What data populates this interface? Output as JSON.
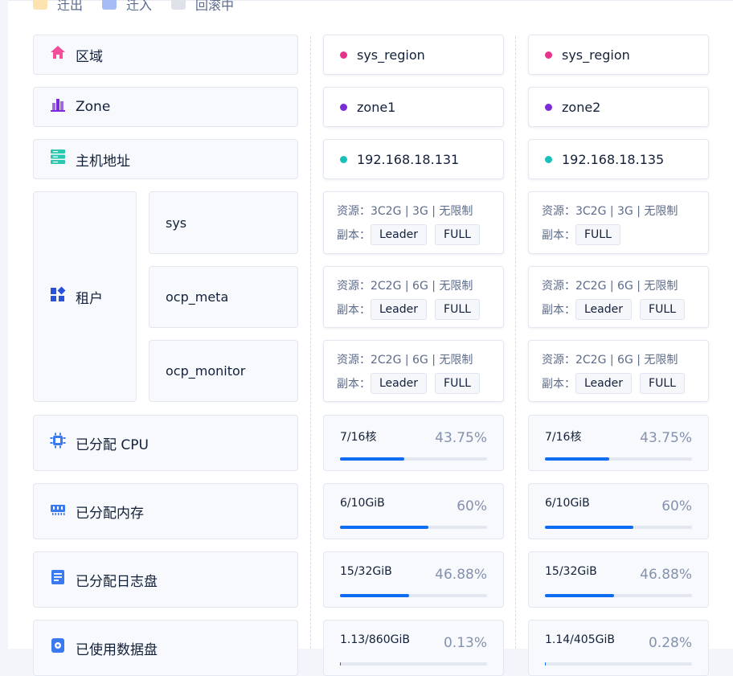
{
  "legend": [
    {
      "label": "迁出",
      "color": "#fde3b0"
    },
    {
      "label": "迁入",
      "color": "#a6bcf7"
    },
    {
      "label": "回滚中",
      "color": "#dfe2e8"
    }
  ],
  "rows": {
    "region": {
      "label": "区域",
      "icon": "home-icon"
    },
    "zone": {
      "label": "Zone",
      "icon": "bar-chart-icon"
    },
    "host": {
      "label": "主机地址",
      "icon": "server-icon"
    },
    "tenant": {
      "label": "租户",
      "icon": "grid-icon"
    },
    "cpu": {
      "label": "已分配 CPU",
      "icon": "cpu-chip-icon"
    },
    "memory": {
      "label": "已分配内存",
      "icon": "memory-icon"
    },
    "log_disk": {
      "label": "已分配日志盘",
      "icon": "log-disk-icon"
    },
    "data_disk": {
      "label": "已使用数据盘",
      "icon": "disk-icon"
    }
  },
  "tenants": [
    "sys",
    "ocp_meta",
    "ocp_monitor"
  ],
  "labels": {
    "resource": "资源：",
    "replica": "副本："
  },
  "colors": {
    "region_dot": "#e8338b",
    "zone_dot": "#7b2cd6",
    "host_dot": "#19c0b8",
    "bar": "#0d6cf2"
  },
  "columns": [
    {
      "region": "sys_region",
      "zone": "zone1",
      "host": "192.168.18.131",
      "tenants": [
        {
          "resource": "3C2G | 3G | 无限制",
          "replicas": [
            "Leader",
            "FULL"
          ]
        },
        {
          "resource": "2C2G | 6G | 无限制",
          "replicas": [
            "Leader",
            "FULL"
          ]
        },
        {
          "resource": "2C2G | 6G | 无限制",
          "replicas": [
            "Leader",
            "FULL"
          ]
        }
      ],
      "cpu": {
        "text": "7/16核",
        "pct": "43.75%",
        "fraction": 0.4375
      },
      "memory": {
        "text": "6/10GiB",
        "pct": "60%",
        "fraction": 0.6
      },
      "log_disk": {
        "text": "15/32GiB",
        "pct": "46.88%",
        "fraction": 0.4688
      },
      "data_disk": {
        "text": "1.13/860GiB",
        "pct": "0.13%",
        "fraction": 0.0013
      }
    },
    {
      "region": "sys_region",
      "zone": "zone2",
      "host": "192.168.18.135",
      "tenants": [
        {
          "resource": "3C2G | 3G | 无限制",
          "replicas": [
            "FULL"
          ]
        },
        {
          "resource": "2C2G | 6G | 无限制",
          "replicas": [
            "Leader",
            "FULL"
          ]
        },
        {
          "resource": "2C2G | 6G | 无限制",
          "replicas": [
            "Leader",
            "FULL"
          ]
        }
      ],
      "cpu": {
        "text": "7/16核",
        "pct": "43.75%",
        "fraction": 0.4375
      },
      "memory": {
        "text": "6/10GiB",
        "pct": "60%",
        "fraction": 0.6
      },
      "log_disk": {
        "text": "15/32GiB",
        "pct": "46.88%",
        "fraction": 0.4688
      },
      "data_disk": {
        "text": "1.14/405GiB",
        "pct": "0.28%",
        "fraction": 0.0028
      }
    }
  ]
}
